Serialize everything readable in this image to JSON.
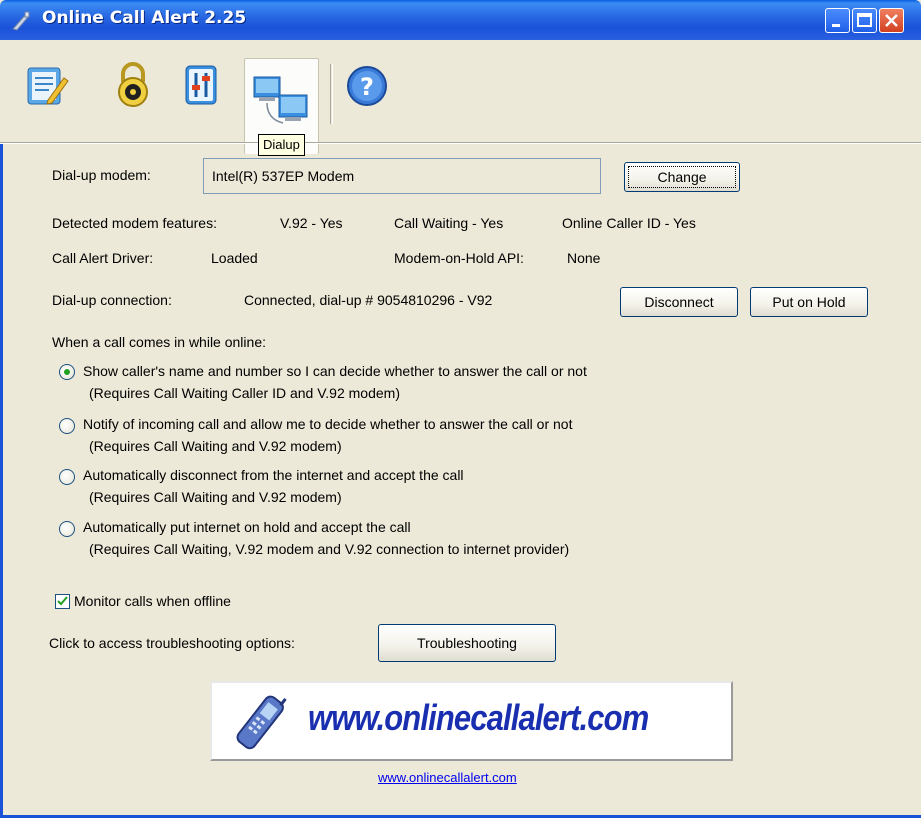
{
  "window": {
    "title": "Online Call Alert 2.25"
  },
  "toolbar": {
    "items": [
      {
        "icon": "notes-icon",
        "label": ""
      },
      {
        "icon": "lock-icon",
        "label": ""
      },
      {
        "icon": "settings-icon",
        "label": ""
      },
      {
        "icon": "dialup-icon",
        "label": "Dialup",
        "selected": true
      },
      {
        "icon": "help-icon",
        "label": ""
      }
    ],
    "tooltip": "Dialup"
  },
  "modem": {
    "label": "Dial-up modem:",
    "value": "Intel(R) 537EP Modem",
    "change_button": "Change"
  },
  "features": {
    "label": "Detected modem features:",
    "v92": "V.92 -  Yes",
    "call_waiting": "Call Waiting -  Yes",
    "caller_id": "Online Caller ID -  Yes"
  },
  "driver": {
    "label": "Call Alert Driver:",
    "value": "Loaded",
    "moh_label": "Modem-on-Hold API:",
    "moh_value": "None"
  },
  "connection": {
    "label": "Dial-up connection:",
    "value": "Connected, dial-up # 9054810296 - V92",
    "disconnect_button": "Disconnect",
    "hold_button": "Put on Hold"
  },
  "options": {
    "heading": "When a call comes in while online:",
    "items": [
      {
        "label": "Show caller's name and number so I can decide whether to answer the call or not",
        "note": "(Requires Call Waiting Caller ID and V.92 modem)",
        "selected": true
      },
      {
        "label": "Notify of incoming call and allow me to decide whether to answer the call or not",
        "note": "(Requires Call Waiting and V.92 modem)",
        "selected": false
      },
      {
        "label": "Automatically disconnect from the internet and accept the call",
        "note": "(Requires Call Waiting and V.92 modem)",
        "selected": false
      },
      {
        "label": "Automatically put internet on hold and accept the call",
        "note": "(Requires Call Waiting, V.92 modem and V.92 connection to internet provider)",
        "selected": false
      }
    ]
  },
  "monitor": {
    "label": "Monitor calls when offline",
    "checked": true
  },
  "troubleshooting": {
    "label": "Click to access troubleshooting options:",
    "button": "Troubleshooting"
  },
  "banner": {
    "text": "www.onlinecallalert.com"
  },
  "footer": {
    "link": "www.onlinecallalert.com"
  },
  "colors": {
    "titlebar": "#2664e0",
    "background": "#ece9d8",
    "banner_text": "#1a2fb0",
    "link": "#0000ee",
    "radio_dot": "#21a121"
  }
}
